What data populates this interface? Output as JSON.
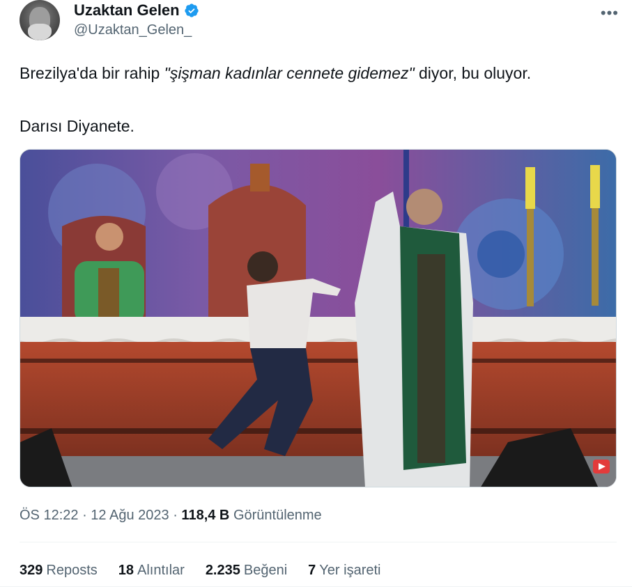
{
  "author": {
    "name": "Uzaktan Gelen",
    "handle": "@Uzaktan_Gelen_",
    "verified": true,
    "verified_color": "#1d9bf0"
  },
  "more_icon": "more-dots-icon",
  "tweet": {
    "text_before": "Brezilya'da bir rahip ",
    "text_quote": "\"şişman kadınlar cennete gidemez\"",
    "text_after": " diyor, bu oluyor.",
    "line2": "Darısı Diyanete."
  },
  "media": {
    "type": "video",
    "badge_icon": "youtube-logo-icon"
  },
  "meta": {
    "time": "ÖS 12:22",
    "sep1": " · ",
    "date": "12 Ağu 2023",
    "sep2": " · ",
    "views": "118,4 B",
    "views_label": "Görüntülenme"
  },
  "stats": [
    {
      "count": "329",
      "label": "Reposts"
    },
    {
      "count": "18",
      "label": "Alıntılar"
    },
    {
      "count": "2.235",
      "label": "Beğeni"
    },
    {
      "count": "7",
      "label": "Yer işareti"
    }
  ],
  "colors": {
    "text": "#0f1419",
    "secondary": "#536471",
    "border": "#cfd9de",
    "accent": "#1d9bf0"
  }
}
